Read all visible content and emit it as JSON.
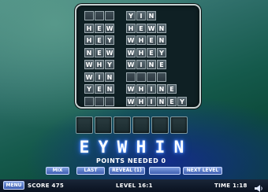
{
  "board": {
    "left_column": [
      {
        "word": "",
        "letters": 3
      },
      {
        "word": "HEW",
        "letters": 3
      },
      {
        "word": "HEY",
        "letters": 3
      },
      {
        "word": "NEW",
        "letters": 3
      },
      {
        "word": "WHY",
        "letters": 3
      },
      {
        "word": "WIN",
        "letters": 3
      },
      {
        "word": "YEN",
        "letters": 3
      },
      {
        "word": "",
        "letters": 3
      }
    ],
    "right_column": [
      {
        "word": "YIN",
        "letters": 3
      },
      {
        "word": "HEWN",
        "letters": 4
      },
      {
        "word": "WHEN",
        "letters": 4
      },
      {
        "word": "WHEY",
        "letters": 4
      },
      {
        "word": "WINE",
        "letters": 4
      },
      {
        "word": "",
        "letters": 4
      },
      {
        "word": "WHINE",
        "letters": 5
      },
      {
        "word": "WHINEY",
        "letters": 6
      }
    ]
  },
  "answer_slots": 6,
  "letter_tiles": [
    "E",
    "Y",
    "W",
    "H",
    "I",
    "N"
  ],
  "points_needed": "POINTS NEEDED 0",
  "buttons": {
    "mix": "MIX",
    "last": "LAST",
    "reveal": "REVEAL (1)",
    "blank": "",
    "next_level": "NEXT LEVEL"
  },
  "status": {
    "menu_label": "MENU",
    "score": "SCORE 475",
    "level": "LEVEL 16:1",
    "time": "TIME 1:18"
  },
  "icons": {
    "sound": "speaker-icon"
  },
  "colors": {
    "tile_glow": "#2a60ff",
    "button": "#4a6cc0",
    "board": "#0f2024"
  }
}
